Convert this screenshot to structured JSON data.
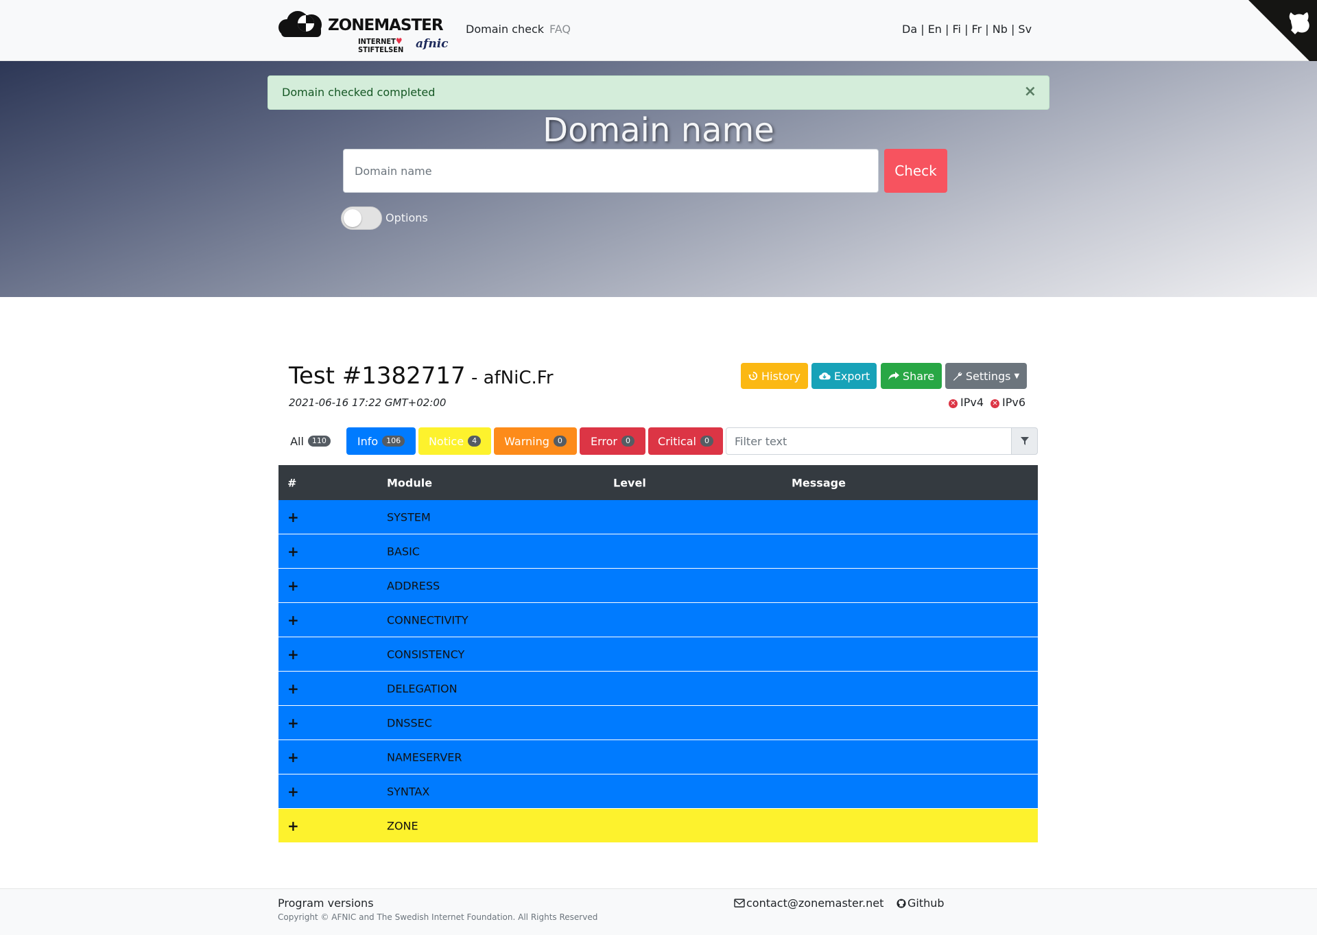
{
  "navbar": {
    "logo": {
      "word": "ZONEMASTER",
      "sub_line1": "INTERNET",
      "sub_line2": "STIFTELSEN",
      "partner": "afnic"
    },
    "links": {
      "domain_check": "Domain check",
      "faq": "FAQ"
    },
    "languages": "Da | En | Fi | Fr | Nb | Sv"
  },
  "hero": {
    "alert": "Domain checked completed",
    "alert_close": "×",
    "title": "Domain name",
    "input_placeholder": "Domain name",
    "check_label": "Check",
    "options_label": "Options"
  },
  "test": {
    "title": "Test #1382717",
    "domain": " - afNiC.Fr",
    "date": "2021-06-16 17:22 GMT+02:00",
    "buttons": {
      "history": "History",
      "export": "Export",
      "share": "Share",
      "settings": "Settings"
    },
    "ip": {
      "ipv4": "IPv4",
      "ipv6": "IPv6"
    }
  },
  "filters": {
    "all": {
      "label": "All",
      "count": "110"
    },
    "info": {
      "label": "Info",
      "count": "106"
    },
    "notice": {
      "label": "Notice",
      "count": "4"
    },
    "warning": {
      "label": "Warning",
      "count": "0"
    },
    "error": {
      "label": "Error",
      "count": "0"
    },
    "critical": {
      "label": "Critical",
      "count": "0"
    },
    "filter_placeholder": "Filter text"
  },
  "table": {
    "headers": {
      "hash": "#",
      "module": "Module",
      "level": "Level",
      "message": "Message"
    },
    "rows": [
      {
        "plus": "+",
        "module": "SYSTEM"
      },
      {
        "plus": "+",
        "module": "BASIC"
      },
      {
        "plus": "+",
        "module": "ADDRESS"
      },
      {
        "plus": "+",
        "module": "CONNECTIVITY"
      },
      {
        "plus": "+",
        "module": "CONSISTENCY"
      },
      {
        "plus": "+",
        "module": "DELEGATION"
      },
      {
        "plus": "+",
        "module": "DNSSEC"
      },
      {
        "plus": "+",
        "module": "NAMESERVER"
      },
      {
        "plus": "+",
        "module": "SYNTAX"
      },
      {
        "plus": "+",
        "module": "ZONE"
      }
    ]
  },
  "footer": {
    "program_versions": "Program versions",
    "copyright": "Copyright © AFNIC and The Swedish Internet Foundation. All Rights Reserved",
    "contact": "contact@zonemaster.net",
    "github": "Github"
  },
  "colors": {
    "info": "#007bff",
    "notice": "#fdf22d",
    "warning": "#fd8b1a",
    "error": "#dc3545",
    "check": "#f7535f",
    "alert_bg": "#d4edda",
    "table_head": "#343a40"
  }
}
